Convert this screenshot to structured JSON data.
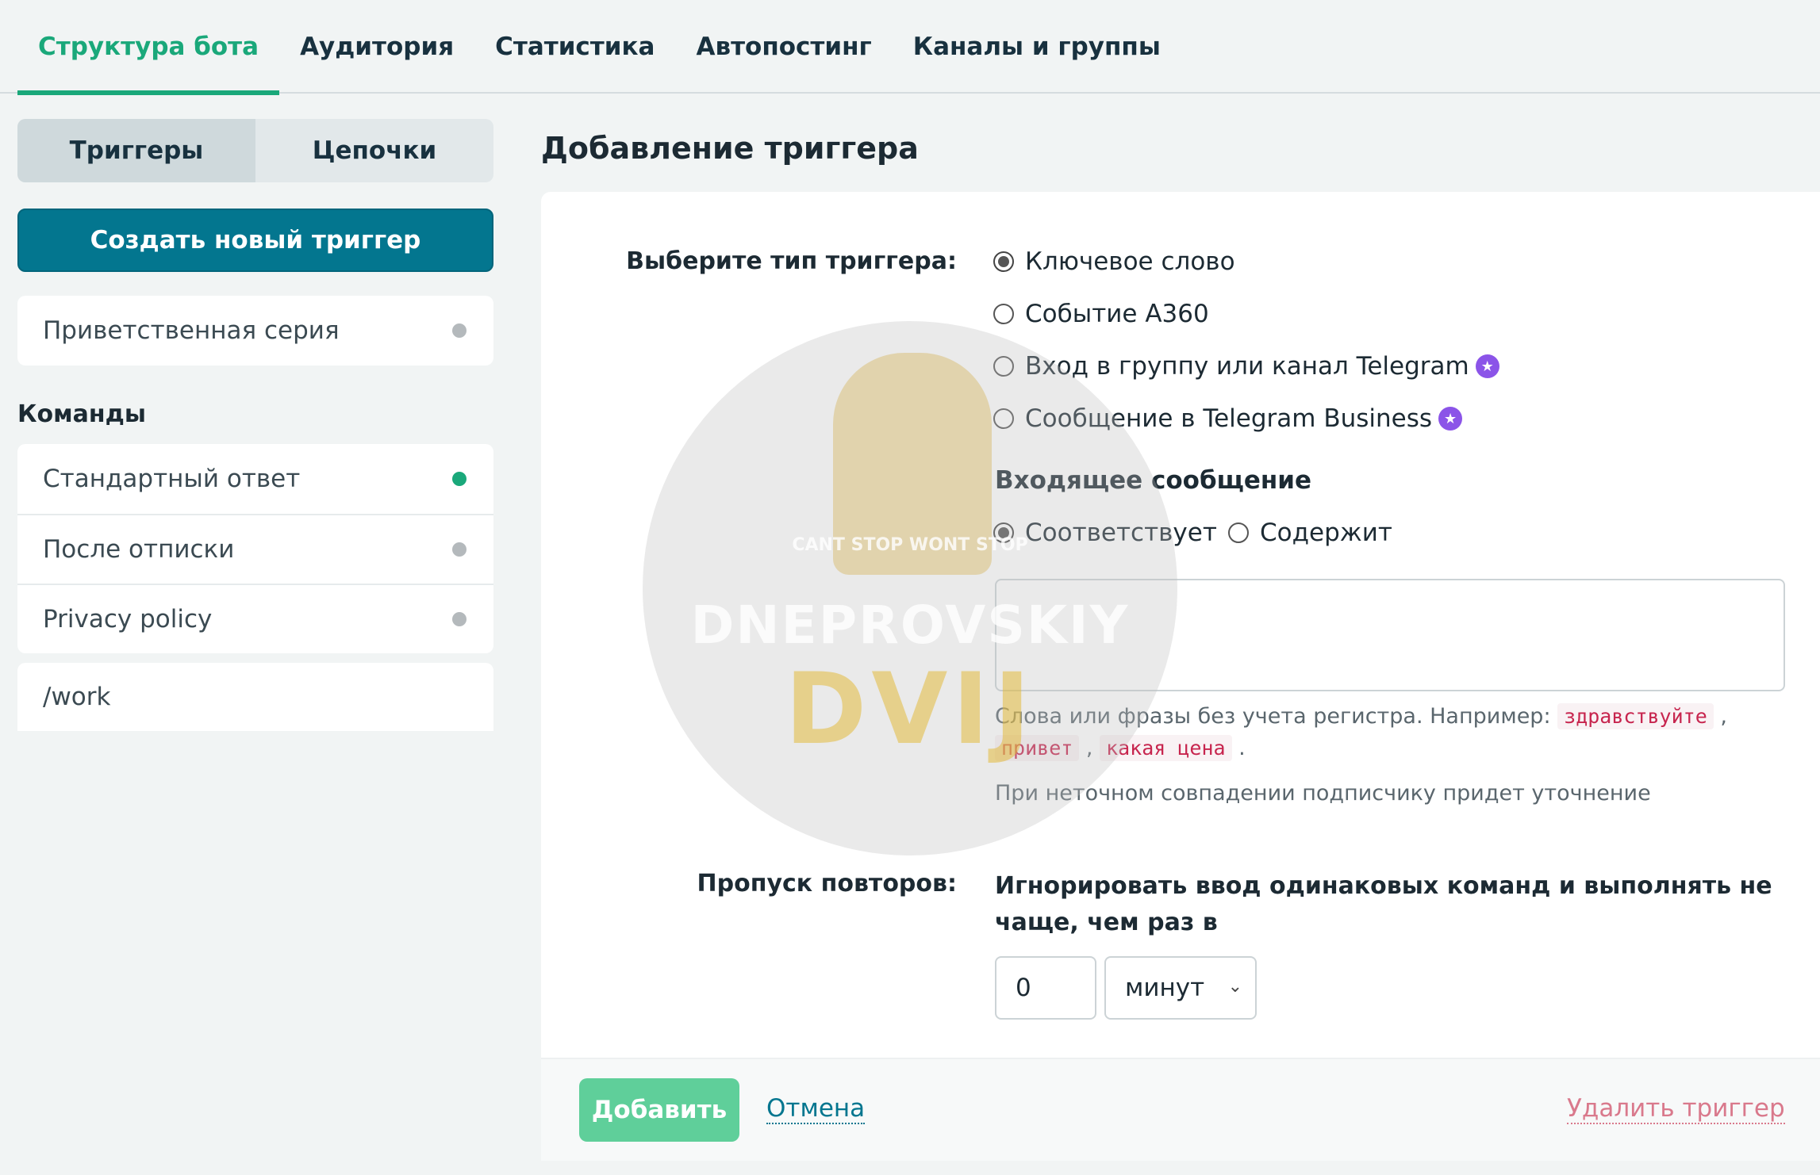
{
  "top_tabs": [
    {
      "label": "Структура бота",
      "active": true
    },
    {
      "label": "Аудитория",
      "active": false
    },
    {
      "label": "Статистика",
      "active": false
    },
    {
      "label": "Автопостинг",
      "active": false
    },
    {
      "label": "Каналы и группы",
      "active": false
    }
  ],
  "segment": {
    "triggers": "Триггеры",
    "chains": "Цепочки",
    "active": "triggers"
  },
  "create_button": "Создать новый триггер",
  "welcome_series": {
    "label": "Приветственная серия",
    "status": "inactive"
  },
  "commands": {
    "title": "Команды",
    "items": [
      {
        "label": "Стандартный ответ",
        "status": "active"
      },
      {
        "label": "После отписки",
        "status": "inactive"
      },
      {
        "label": "Privacy policy",
        "status": "inactive"
      }
    ]
  },
  "extra_item": {
    "label": "/work"
  },
  "form": {
    "title": "Добавление триггера",
    "trigger_type_label": "Выберите тип триггера:",
    "trigger_types": [
      {
        "label": "Ключевое слово",
        "checked": true,
        "premium": false
      },
      {
        "label": "Событие A360",
        "checked": false,
        "premium": false
      },
      {
        "label": "Вход в группу или канал Telegram",
        "checked": false,
        "premium": true
      },
      {
        "label": "Сообщение в Telegram Business",
        "checked": false,
        "premium": true
      }
    ],
    "incoming_title": "Входящее сообщение",
    "match_options": [
      {
        "label": "Соответствует",
        "checked": true
      },
      {
        "label": "Содержит",
        "checked": false
      }
    ],
    "keywords_value": "",
    "hint_prefix": "Слова или фразы без учета регистра. Например:",
    "hint_examples": [
      "здравствуйте",
      "привет",
      "какая цена"
    ],
    "hint_fuzzy": "При неточном совпадении подписчику придет уточнение",
    "repeat_label": "Пропуск повторов:",
    "repeat_text": "Игнорировать ввод одинаковых команд и выполнять не чаще, чем раз в",
    "repeat_value": "0",
    "repeat_unit": "минут",
    "add_button": "Добавить",
    "cancel_link": "Отмена",
    "delete_link": "Удалить триггер"
  },
  "watermark": {
    "line1": "DNEPROVSKIY",
    "line2": "DVIJ",
    "small": "CANT STOP WONT STOP"
  },
  "colors": {
    "accent": "#1aa87a",
    "primary": "#03768f",
    "premium": "#8b54e8",
    "danger": "#d9798c"
  },
  "icons": {
    "premium": "star-icon",
    "select": "chevron-down-icon",
    "status": "dot-icon"
  }
}
